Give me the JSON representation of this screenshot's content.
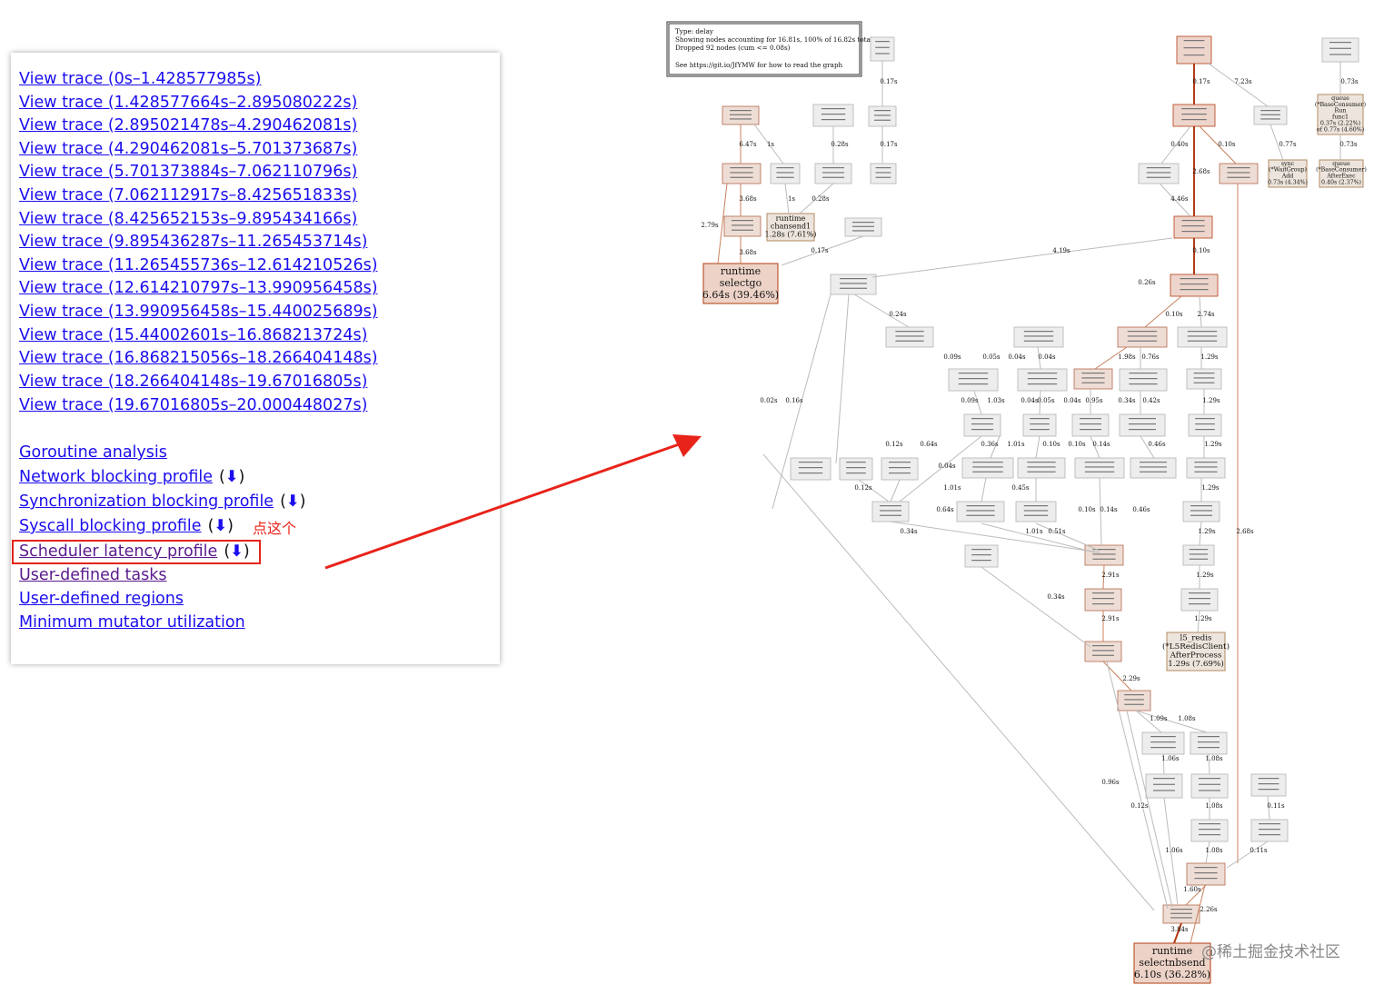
{
  "trace_links": [
    "View trace (0s–1.428577985s)",
    "View trace (1.428577664s–2.895080222s)",
    "View trace (2.895021478s–4.290462081s)",
    "View trace (4.290462081s–5.701373687s)",
    "View trace (5.701373884s–7.062110796s)",
    "View trace (7.062112917s–8.425651833s)",
    "View trace (8.425652153s–9.895434166s)",
    "View trace (9.895436287s–11.265453714s)",
    "View trace (11.265455736s–12.614210526s)",
    "View trace (12.614210797s–13.990956458s)",
    "View trace (13.990956458s–15.440025689s)",
    "View trace (15.44002601s–16.868213724s)",
    "View trace (16.868215056s–18.266404148s)",
    "View trace (18.266404148s–19.67016805s)",
    "View trace (19.67016805s–20.000448027s)"
  ],
  "analysis_links": {
    "goroutine": "Goroutine analysis",
    "network": "Network blocking profile",
    "sync": "Synchronization blocking profile",
    "syscall": "Syscall blocking profile",
    "scheduler": "Scheduler latency profile",
    "tasks": "User-defined tasks",
    "regions": "User-defined regions",
    "mmu": "Minimum mutator utilization",
    "download_open": "(",
    "download_icon": "⬇",
    "download_close": ")"
  },
  "annotation": "点这个",
  "graph": {
    "legend": [
      "Type: delay",
      "Showing nodes accounting for 16.81s, 100% of 16.82s total",
      "Dropped 92 nodes (cum <= 0.08s)",
      "See https://git.io/JfYMW for how to read the graph"
    ],
    "nodes": {
      "selectgo": [
        "runtime",
        "selectgo",
        "6.64s (39.46%)"
      ],
      "selectnbsend": [
        "runtime",
        "selectnbsend",
        "6.10s (36.28%)"
      ],
      "chansend1": [
        "runtime",
        "chansend1",
        "1.28s (7.61%)"
      ],
      "waitgroup": [
        "sync",
        "(*WaitGroup)",
        "Add",
        "0.73s (4.34%)"
      ],
      "l5redis": [
        "l5_redis",
        "(*L5RedisClient)",
        "AfterProcess",
        "1.29s (7.69%)"
      ],
      "queue_run": [
        "queue",
        "(*BaseConsumer)",
        "Run",
        "func1",
        "0.37s (2.22%)",
        "of 0.77s (4.60%)"
      ],
      "queue_after": [
        "queue",
        "(*BaseConsumer)",
        "AfterExec",
        "0.40s (2.37%)"
      ]
    },
    "edge_labels": [
      "6.47s",
      "1s",
      "0.28s",
      "0.17s",
      "0.17s",
      "3.68s",
      "3.68s",
      "2.79s",
      "1s",
      "0.28s",
      "0.17s",
      "0.17s",
      "7.23s",
      "0.73s",
      "0.77s",
      "0.73s",
      "0.40s",
      "0.10s",
      "2.68s",
      "4.46s",
      "0.10s",
      "4.19s",
      "0.26s",
      "0.10s",
      "2.74s",
      "1.29s",
      "1.29s",
      "1.29s",
      "1.29s",
      "1.29s",
      "1.29s",
      "1.29s",
      "0.24s",
      "0.09s",
      "0.05s",
      "0.04s",
      "0.04s",
      "1.98s",
      "0.76s",
      "0.09s",
      "1.03s",
      "0.04s",
      "0.05s",
      "0.04s",
      "0.95s",
      "0.34s",
      "0.42s",
      "0.02s",
      "0.16s",
      "0.12s",
      "0.64s",
      "0.36s",
      "1.01s",
      "0.10s",
      "0.10s",
      "0.14s",
      "0.46s",
      "0.04s",
      "0.12s",
      "1.01s",
      "0.45s",
      "0.64s",
      "0.10s",
      "0.14s",
      "0.46s",
      "0.34s",
      "1.01s",
      "0.51s",
      "2.91s",
      "0.34s",
      "2.91s",
      "2.29s",
      "1.09s",
      "1.08s",
      "1.06s",
      "1.08s",
      "0.96s",
      "0.12s",
      "1.08s",
      "1.06s",
      "1.08s",
      "0.11s",
      "0.11s",
      "1.60s",
      "2.26s",
      "3.84s",
      "2.68s"
    ]
  },
  "watermark": "@稀土掘金技术社区"
}
